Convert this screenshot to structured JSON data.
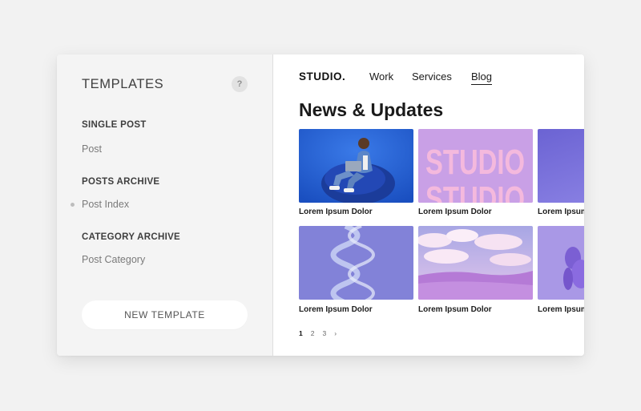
{
  "sidebar": {
    "title": "TEMPLATES",
    "help_label": "?",
    "groups": [
      {
        "title": "SINGLE POST",
        "items": [
          "Post"
        ]
      },
      {
        "title": "POSTS ARCHIVE",
        "items": [
          "Post Index"
        ]
      },
      {
        "title": "CATEGORY ARCHIVE",
        "items": [
          "Post Category"
        ]
      }
    ],
    "active_item": "Post Index",
    "new_template_label": "NEW TEMPLATE"
  },
  "preview": {
    "logo": "STUDIO.",
    "nav": [
      "Work",
      "Services",
      "Blog"
    ],
    "active_nav": "Blog",
    "heading": "News & Updates",
    "cards": [
      {
        "caption": "Lorem Ipsum Dolor",
        "image": "person-on-beanbag-photo"
      },
      {
        "caption": "Lorem Ipsum Dolor",
        "image": "studio-typography-poster",
        "poster_text": "STUDIO"
      },
      {
        "caption": "Lorem Ipsum Dolor",
        "image": "purple-gradient-photo"
      },
      {
        "caption": "Lorem Ipsum Dolor",
        "image": "glass-helix-photo"
      },
      {
        "caption": "Lorem Ipsum Dolor",
        "image": "pink-clouds-landscape-photo"
      },
      {
        "caption": "Lorem Ipsum Dolor",
        "image": "balloon-dog-photo"
      }
    ],
    "pagination": {
      "pages": [
        "1",
        "2",
        "3"
      ],
      "current": "1",
      "next": "›"
    }
  },
  "colors": {
    "sidebar_bg": "#f4f4f4",
    "page_bg": "#f2f2f2",
    "accent_purple": "#8b86d8",
    "blue_photo": "#1f56c8"
  }
}
